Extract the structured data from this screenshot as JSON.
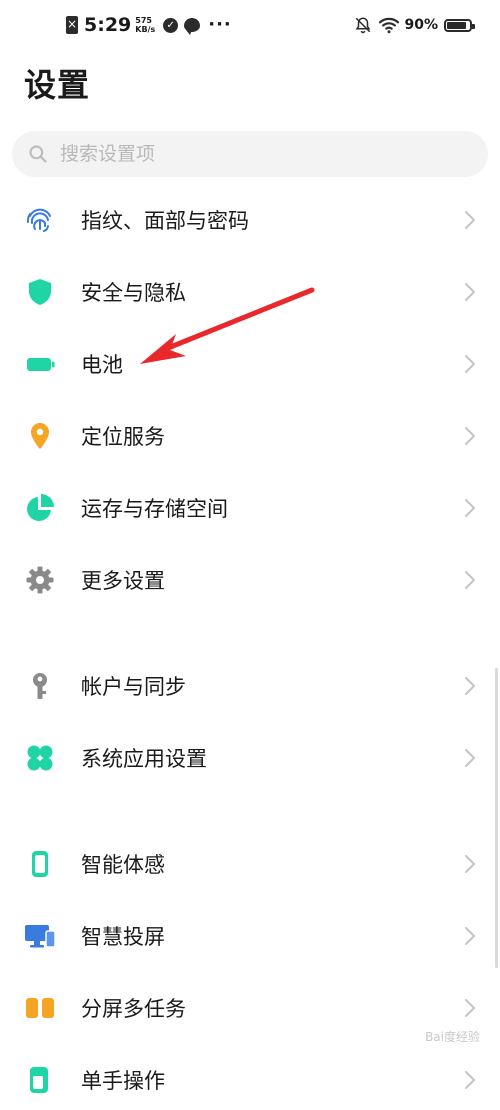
{
  "status_bar": {
    "time": "5:29",
    "net_speed_value": "575",
    "net_speed_unit": "KB/s",
    "more": "···",
    "battery": "90%"
  },
  "page": {
    "title": "设置"
  },
  "search": {
    "placeholder": "搜索设置项"
  },
  "groups": [
    {
      "items": [
        {
          "label": "指纹、面部与密码",
          "icon": "fingerprint-icon",
          "color": "#3a7be0"
        },
        {
          "label": "安全与隐私",
          "icon": "shield-icon",
          "color": "#1fd4a5"
        },
        {
          "label": "电池",
          "icon": "battery-icon",
          "color": "#1fd4a5"
        },
        {
          "label": "定位服务",
          "icon": "location-pin-icon",
          "color": "#f5a524"
        },
        {
          "label": "运存与存储空间",
          "icon": "pie-chart-icon",
          "color": "#1fd4a5"
        },
        {
          "label": "更多设置",
          "icon": "gear-icon",
          "color": "#8a8a8a"
        }
      ]
    },
    {
      "items": [
        {
          "label": "帐户与同步",
          "icon": "key-icon",
          "color": "#8a8a8a"
        },
        {
          "label": "系统应用设置",
          "icon": "clover-icon",
          "color": "#1fd4a5"
        }
      ]
    },
    {
      "items": [
        {
          "label": "智能体感",
          "icon": "phone-motion-icon",
          "color": "#1fd4a5"
        },
        {
          "label": "智慧投屏",
          "icon": "screen-cast-icon",
          "color": "#3a7be0"
        },
        {
          "label": "分屏多任务",
          "icon": "split-screen-icon",
          "color": "#f5a524"
        },
        {
          "label": "单手操作",
          "icon": "one-hand-icon",
          "color": "#1fd4a5"
        }
      ]
    }
  ],
  "watermark": "Bai度经验"
}
